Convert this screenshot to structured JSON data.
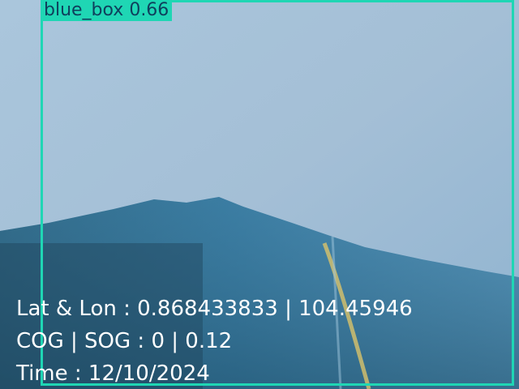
{
  "detection": {
    "label": "blue_box 0.66",
    "class": "blue_box",
    "confidence": 0.66,
    "box_color": "#1fd6b4"
  },
  "telemetry": {
    "lat_lon": "Lat & Lon : 0.868433833 | 104.45946",
    "cog_sog": "COG | SOG : 0 | 0.12",
    "time": "Time : 12/10/2024"
  }
}
